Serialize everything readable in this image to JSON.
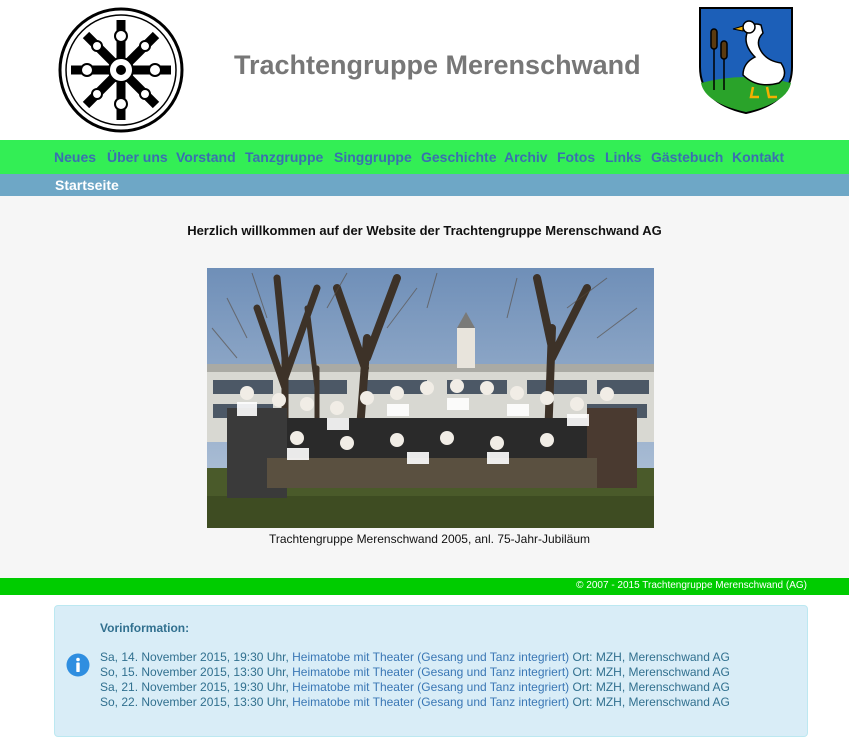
{
  "header": {
    "title": "Trachtengruppe Merenschwand",
    "logo_left": "trachten-emblem",
    "logo_right": "swan-coat-of-arms"
  },
  "nav": {
    "items": [
      {
        "label": "Neues"
      },
      {
        "label": "Über uns"
      },
      {
        "label": "Vorstand"
      },
      {
        "label": "Tanzgruppe"
      },
      {
        "label": "Singgruppe"
      },
      {
        "label": "Geschichte"
      },
      {
        "label": "Archiv"
      },
      {
        "label": "Fotos"
      },
      {
        "label": "Links"
      },
      {
        "label": "Gästebuch"
      },
      {
        "label": "Kontakt"
      }
    ],
    "sub": {
      "label": "Startseite"
    }
  },
  "main": {
    "welcome": "Herzlich willkommen auf der Website der Trachtengruppe Merenschwand AG",
    "caption": "Trachtengruppe Merenschwand 2005, anl. 75-Jahr-Jubiläum"
  },
  "footer": {
    "copyright": "© 2007 - 2015 Trachtengruppe Merenschwand (AG)"
  },
  "info": {
    "title": "Vorinformation:",
    "icon": "info-icon",
    "events": [
      {
        "date": "Sa, 14. November 2015, 19:30 Uhr,",
        "link": "Heimatobe mit Theater (Gesang und Tanz integriert)",
        "place": "Ort: MZH, Merenschwand AG"
      },
      {
        "date": "So, 15. November 2015, 13:30 Uhr,",
        "link": "Heimatobe mit Theater (Gesang und Tanz integriert)",
        "place": "Ort: MZH, Merenschwand AG"
      },
      {
        "date": "Sa, 21. November 2015, 19:30 Uhr,",
        "link": "Heimatobe mit Theater (Gesang und Tanz integriert)",
        "place": "Ort: MZH, Merenschwand AG"
      },
      {
        "date": "So, 22. November 2015, 13:30 Uhr,",
        "link": "Heimatobe mit Theater (Gesang und Tanz integriert)",
        "place": "Ort: MZH, Merenschwand AG"
      }
    ]
  },
  "colors": {
    "nav_bg": "#33ee55",
    "nav_text": "#3a6fb0",
    "subnav_bg": "#6ea7c6",
    "footer_bg": "#00cc00",
    "info_bg": "#d9edf7"
  }
}
